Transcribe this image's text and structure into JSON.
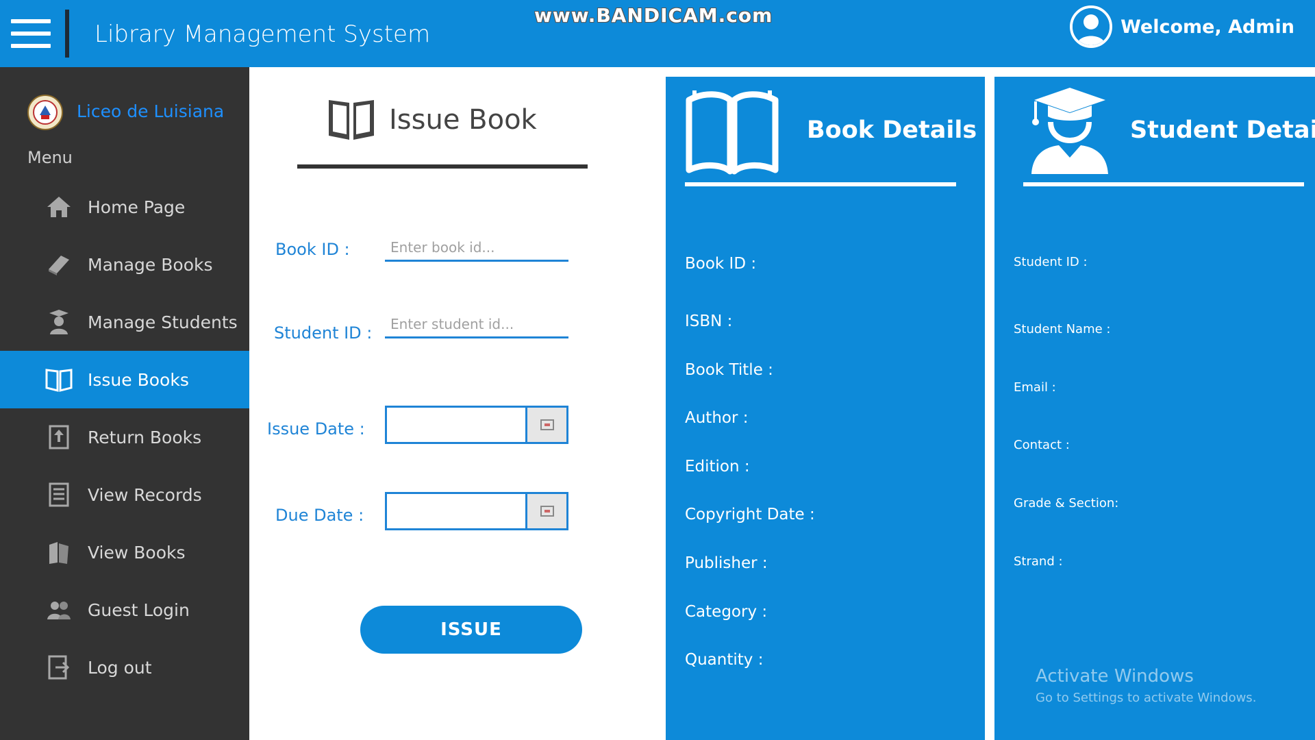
{
  "header": {
    "title": "Library Management System",
    "watermark": "www.BANDICAM.com",
    "welcome": "Welcome, Admin"
  },
  "sidebar": {
    "org_name": "Liceo de Luisiana",
    "menu_label": "Menu",
    "items": [
      {
        "label": "Home Page",
        "icon": "home-icon"
      },
      {
        "label": "Manage Books",
        "icon": "book-icon"
      },
      {
        "label": "Manage Students",
        "icon": "student-icon"
      },
      {
        "label": "Issue Books",
        "icon": "open-book-icon",
        "active": true
      },
      {
        "label": "Return Books",
        "icon": "return-icon"
      },
      {
        "label": "View Records",
        "icon": "list-icon"
      },
      {
        "label": "View Books",
        "icon": "books-icon"
      },
      {
        "label": "Guest Login",
        "icon": "users-icon"
      },
      {
        "label": "Log out",
        "icon": "logout-icon"
      }
    ]
  },
  "issue_form": {
    "title": "Issue Book",
    "book_id_label": "Book ID :",
    "book_id_placeholder": "Enter book id...",
    "student_id_label": "Student ID :",
    "student_id_placeholder": "Enter student id...",
    "issue_date_label": "Issue Date :",
    "due_date_label": "Due Date :",
    "issue_button": "ISSUE"
  },
  "book_details": {
    "title": "Book Details",
    "fields": [
      "Book ID :",
      "ISBN :",
      "Book Title :",
      "Author :",
      "Edition :",
      "Copyright Date :",
      "Publisher :",
      "Category :",
      "Quantity :"
    ]
  },
  "student_details": {
    "title": "Student Details",
    "fields": [
      "Student ID :",
      "Student Name :",
      "Email :",
      "Contact :",
      "Grade & Section:",
      "Strand :"
    ]
  },
  "os_overlay": {
    "line1": "Activate Windows",
    "line2": "Go to Settings to activate Windows."
  },
  "colors": {
    "primary_blue": "#0d8ad9",
    "sidebar_bg": "#333333",
    "label_blue": "#1f84d6"
  }
}
